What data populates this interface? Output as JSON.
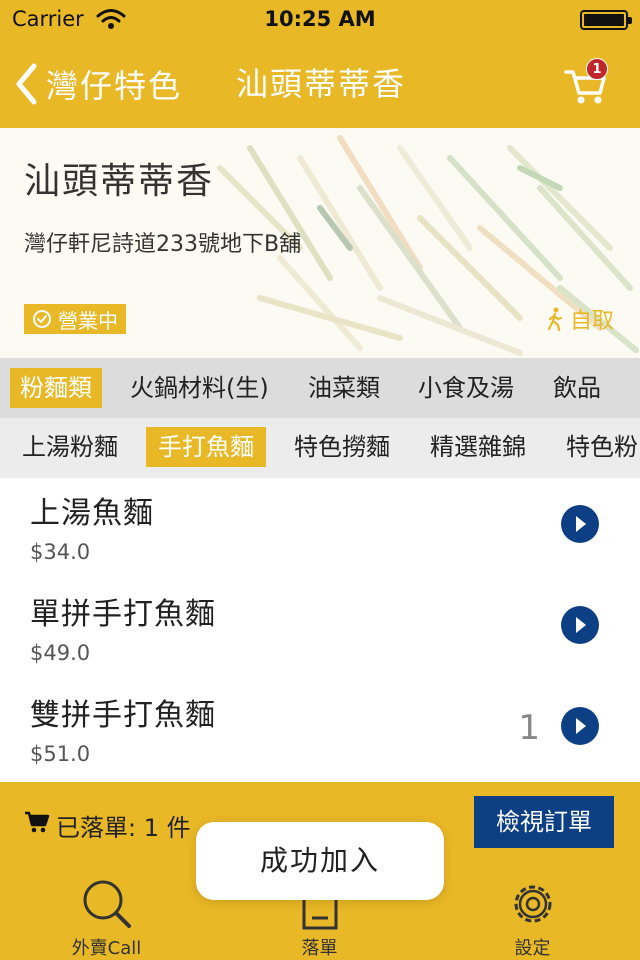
{
  "status_bar": {
    "carrier": "Carrier",
    "time": "10:25 AM"
  },
  "nav": {
    "back_label": "灣仔特色",
    "title": "汕頭蒂蒂香",
    "cart_badge": "1"
  },
  "shop": {
    "name": "汕頭蒂蒂香",
    "address": "灣仔軒尼詩道233號地下B舖",
    "status": "營業中",
    "pickup": "自取"
  },
  "categories": [
    {
      "label": "粉麵類",
      "active": true
    },
    {
      "label": "火鍋材料(生)",
      "active": false
    },
    {
      "label": "油菜類",
      "active": false
    },
    {
      "label": "小食及湯",
      "active": false
    },
    {
      "label": "飲品",
      "active": false
    }
  ],
  "subcategories": [
    {
      "label": "上湯粉麵",
      "active": false
    },
    {
      "label": "手打魚麵",
      "active": true
    },
    {
      "label": "特色撈麵",
      "active": false
    },
    {
      "label": "精選雜錦",
      "active": false
    },
    {
      "label": "特色粉",
      "active": false
    }
  ],
  "menu_items": [
    {
      "name": "上湯魚麵",
      "price": "$34.0",
      "qty": ""
    },
    {
      "name": "單拼手打魚麵",
      "price": "$49.0",
      "qty": ""
    },
    {
      "name": "雙拼手打魚麵",
      "price": "$51.0",
      "qty": "1"
    }
  ],
  "order_bar": {
    "summary": "已落單: 1 件",
    "view_button": "檢視訂單"
  },
  "toast": "成功加入",
  "tabs": [
    {
      "label": "外賣Call",
      "icon": "search-icon"
    },
    {
      "label": "落單",
      "icon": "order-icon"
    },
    {
      "label": "設定",
      "icon": "gear-icon"
    }
  ],
  "colors": {
    "brand_yellow": "#e9b826",
    "button_blue": "#0d3f84",
    "badge_red": "#c0272d"
  }
}
